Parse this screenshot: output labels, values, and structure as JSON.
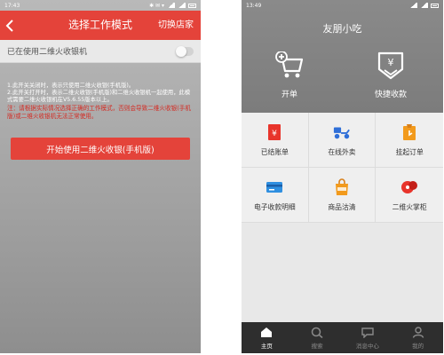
{
  "left": {
    "status": {
      "time": "17:43",
      "indicators": "✱ ✉ ▾",
      "battery": ""
    },
    "nav": {
      "title": "选择工作模式",
      "switch_label": "切换店家"
    },
    "toggle_row": {
      "label": "已在使用二维火收银机",
      "enabled": false
    },
    "description": [
      "1.此开关关闭时，表示只使用二维火收银(手机版)。",
      "2.此开关打开时，表示二维火收银(手机版)和二维火收银机一起使用，此模式需要二维火收银机在V5.6.55版本以上。"
    ],
    "warning": "注：请根据实际情况选择正确的工作模式，否则会导致二维火收银(手机版)或二维火收银机无法正常使用。",
    "start_button": "开始使用二维火收银(手机版)",
    "colors": {
      "accent": "#e4433a",
      "warning": "#d42a22"
    }
  },
  "right": {
    "status": {
      "time": "13:49"
    },
    "title": "友朋小吃",
    "quick_actions": [
      {
        "label": "开单",
        "icon": "cart-add-icon"
      },
      {
        "label": "快捷收款",
        "icon": "quick-pay-icon"
      }
    ],
    "grid": [
      {
        "label": "已结账单",
        "icon": "settled-bill-icon",
        "color": "#e8342b"
      },
      {
        "label": "在线外卖",
        "icon": "delivery-scooter-icon",
        "color": "#2f6fd8"
      },
      {
        "label": "挂起订单",
        "icon": "pending-order-icon",
        "color": "#f29a1c"
      },
      {
        "label": "电子收款明细",
        "icon": "card-payment-icon",
        "color": "#2f8fe0"
      },
      {
        "label": "商品沽清",
        "icon": "sold-out-bag-icon",
        "color": "#f29a1c"
      },
      {
        "label": "二维火掌柜",
        "icon": "manager-icon",
        "color": "#e8342b"
      }
    ],
    "tabs": [
      {
        "label": "主页",
        "icon": "home-icon",
        "active": true
      },
      {
        "label": "搜索",
        "icon": "search-icon",
        "active": false
      },
      {
        "label": "消息中心",
        "icon": "message-icon",
        "active": false
      },
      {
        "label": "我的",
        "icon": "profile-icon",
        "active": false
      }
    ]
  }
}
